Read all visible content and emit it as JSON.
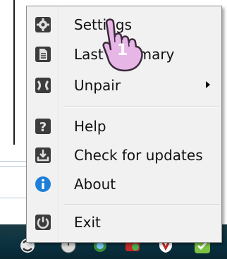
{
  "menu": {
    "items": [
      {
        "label": "Settings",
        "icon": "gear-icon"
      },
      {
        "label": "Last summary",
        "icon": "document-icon"
      },
      {
        "label": "Unpair",
        "icon": "unpair-icon",
        "submenu": true
      },
      {
        "label": "Help",
        "icon": "help-icon"
      },
      {
        "label": "Check for updates",
        "icon": "download-icon"
      },
      {
        "label": "About",
        "icon": "info-icon"
      },
      {
        "label": "Exit",
        "icon": "power-icon"
      }
    ]
  },
  "annotation": {
    "step": "1"
  },
  "colors": {
    "menu_bg": "#f1f1f1",
    "taskbar": "#0a3140",
    "cursor": "#e6b6e6",
    "info_blue": "#1e7fd8"
  }
}
